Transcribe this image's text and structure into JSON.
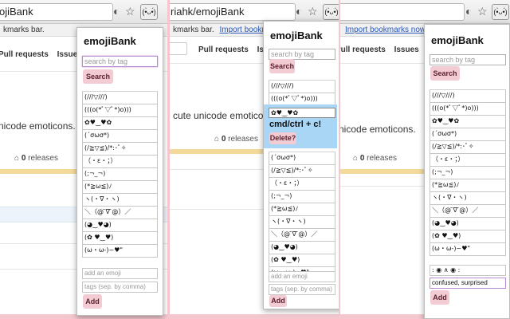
{
  "browser": {
    "url_left": "ojiBank",
    "url_mid": "riahk/emojiBank",
    "ext_icon": "(•̀ᴗ•́)",
    "bookmark_text": "kmarks bar.",
    "import_link": "Import bookmarks n",
    "import_link_full": "Import bookmarks now",
    "star_icon": "star-icon",
    "reader_icon": "half-circle-icon"
  },
  "page": {
    "tab_pulls": "Pull requests",
    "tab_issues": "Issues",
    "description": "e cute unicode emoticons.",
    "description_left": "nicode emoticons.",
    "description_right": "nicode emoticons.",
    "releases_count": "0",
    "releases_label": "releases"
  },
  "popup": {
    "title": "emojiBank",
    "search_placeholder": "search by tag",
    "search_button": "Search",
    "add_emoji_placeholder": "add an emoji",
    "tags_placeholder": "tags (sep. by comma)",
    "add_button": "Add",
    "emojis": [
      "(///▽///)",
      "(((o(*ﾟ▽ﾟ*)o)))",
      "✿♥‿♥✿",
      "(´σωσ*)",
      "(/≧▽≦)/*:･ﾟ✧",
      "（・ε・；）",
      "(;¬_¬)",
      "(*≧ω≦)ﾉ",
      "ヽ(・∇・ヽ)",
      "＼（@ ̄∇ ̄@）／",
      "(◕‿♥◕)",
      "(✿ ♥‿♥)",
      "(ω・ω-)~♥\""
    ]
  },
  "popup_mid": {
    "selected_emoji": "✿♥‿♥✿",
    "copy_hint": "cmd/ctrl + c!",
    "delete_button": "Delete?"
  },
  "popup_right": {
    "new_emoji_value": ": ◉ ∧ ◉ :",
    "new_tags_value": "confused, surprised"
  }
}
